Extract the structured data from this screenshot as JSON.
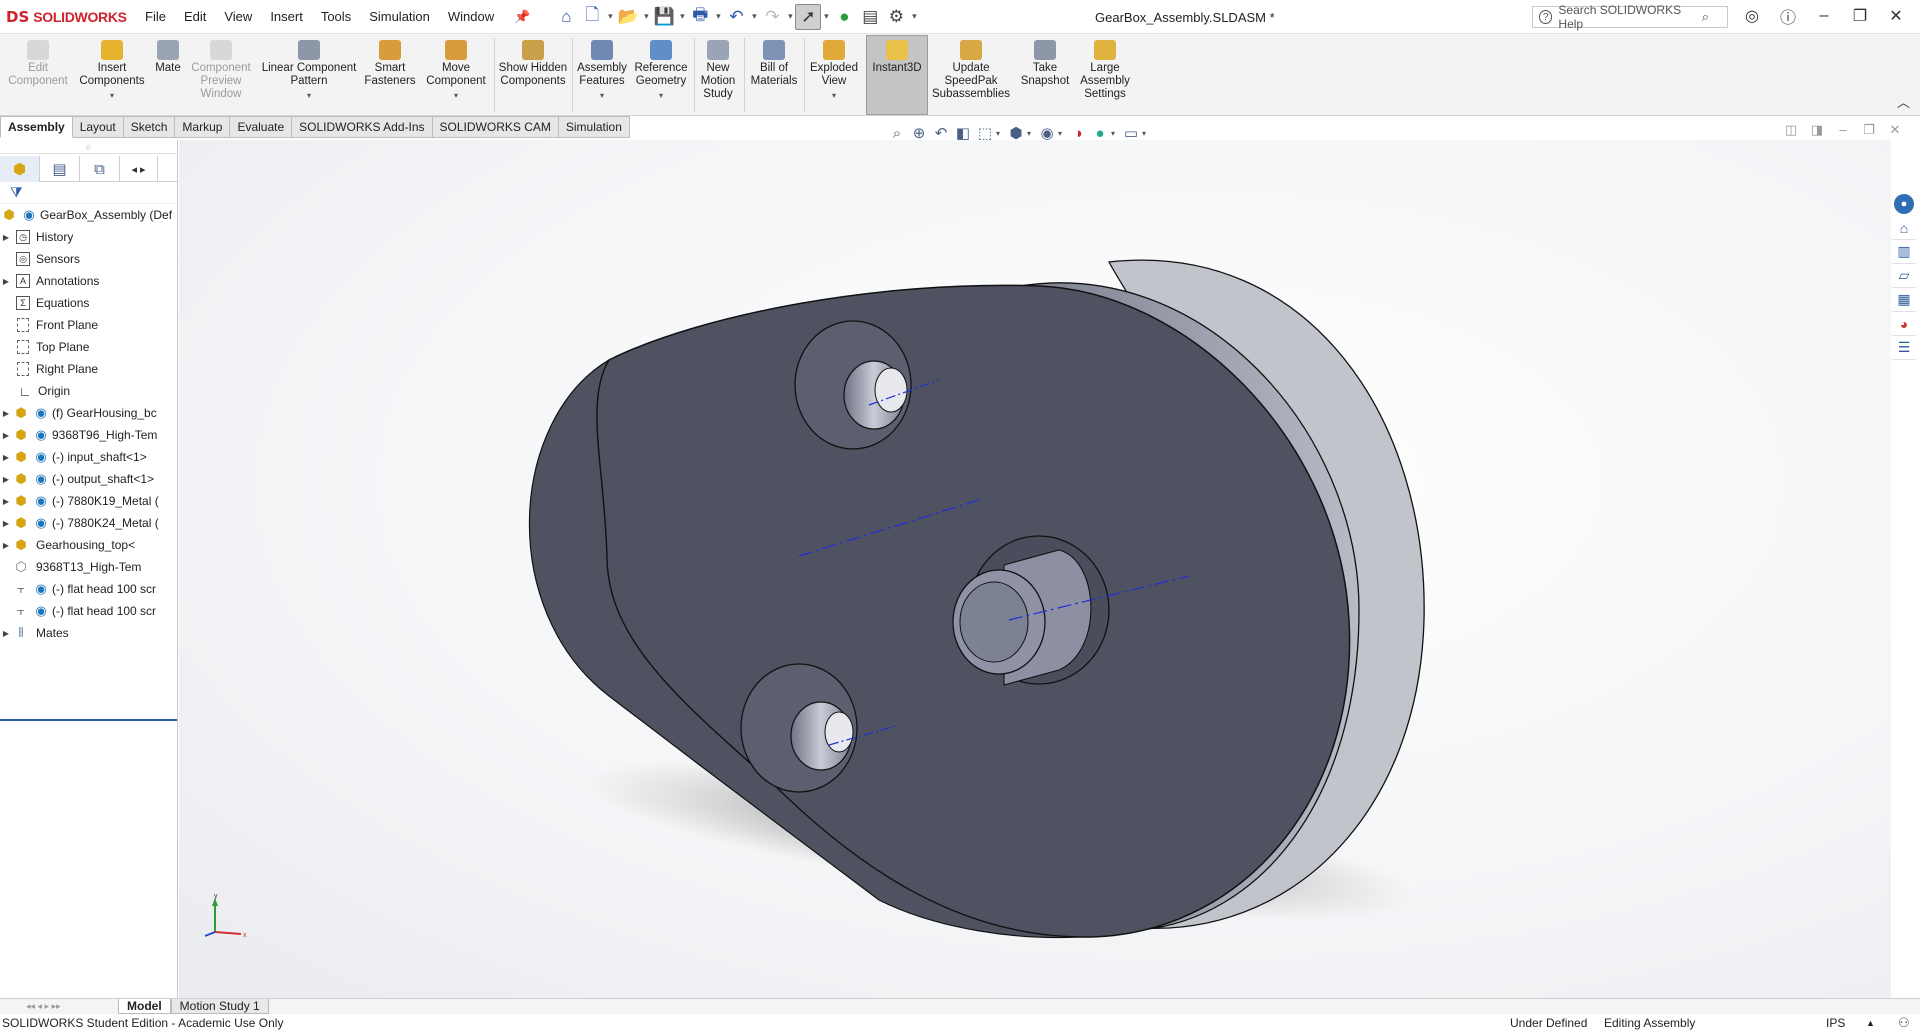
{
  "app": {
    "logo_ds": "DS",
    "logo_text": "SOLIDWORKS",
    "doc_title": "GearBox_Assembly.SLDASM *"
  },
  "menu": [
    "File",
    "Edit",
    "View",
    "Insert",
    "Tools",
    "Simulation",
    "Window"
  ],
  "search": {
    "placeholder": "Search SOLIDWORKS Help"
  },
  "ribbon": {
    "edit_component": "Edit Component",
    "insert_components": "Insert Components",
    "mate": "Mate",
    "component_preview": "Component Preview Window",
    "linear_pattern": "Linear Component Pattern",
    "smart_fasteners": "Smart Fasteners",
    "move_component": "Move Component",
    "show_hidden": "Show Hidden Components",
    "assembly_features": "Assembly Features",
    "reference_geometry": "Reference Geometry",
    "new_motion_study": "New Motion Study",
    "bill_of_materials": "Bill of Materials",
    "exploded_view": "Exploded View",
    "instant3d": "Instant3D",
    "update_speedpak": "Update SpeedPak Subassemblies",
    "take_snapshot": "Take Snapshot",
    "large_assembly": "Large Assembly Settings"
  },
  "tabs": [
    "Assembly",
    "Layout",
    "Sketch",
    "Markup",
    "Evaluate",
    "SOLIDWORKS Add-Ins",
    "SOLIDWORKS CAM",
    "Simulation"
  ],
  "active_tab": "Assembly",
  "tree": {
    "root": "GearBox_Assembly (Def",
    "history": "History",
    "sensors": "Sensors",
    "annotations": "Annotations",
    "equations": "Equations",
    "front_plane": "Front Plane",
    "top_plane": "Top Plane",
    "right_plane": "Right Plane",
    "origin": "Origin",
    "components": [
      "(f) GearHousing_bc",
      "9368T96_High-Tem",
      "(-) input_shaft<1>",
      "(-) output_shaft<1>",
      "(-) 7880K19_Metal (",
      "(-) 7880K24_Metal (",
      "Gearhousing_top<",
      "9368T13_High-Tem",
      "(-) flat head 100 scr",
      "(-) flat head 100 scr"
    ],
    "mates": "Mates"
  },
  "bottom_tabs": [
    "Model",
    "Motion Study 1"
  ],
  "status": {
    "edition": "SOLIDWORKS Student Edition - Academic Use Only",
    "definition": "Under Defined",
    "mode": "Editing Assembly",
    "units": "IPS"
  },
  "triad": {
    "x": "x",
    "y": "y"
  },
  "colors": {
    "brand_red": "#d0222c",
    "part_face": "#4f5361",
    "part_side": "#8a8d9c",
    "axis_blue": "#1f2fd6",
    "viewport_bg": "#f3f4f6"
  },
  "icons": {
    "home": "home-icon",
    "new": "new-document-icon",
    "open": "open-icon",
    "save": "save-icon",
    "print": "print-icon",
    "undo": "undo-icon",
    "redo": "redo-icon",
    "select": "select-arrow-icon",
    "rebuild": "rebuild-traffic-light-icon",
    "file_props": "file-properties-icon",
    "options": "gear-icon"
  }
}
